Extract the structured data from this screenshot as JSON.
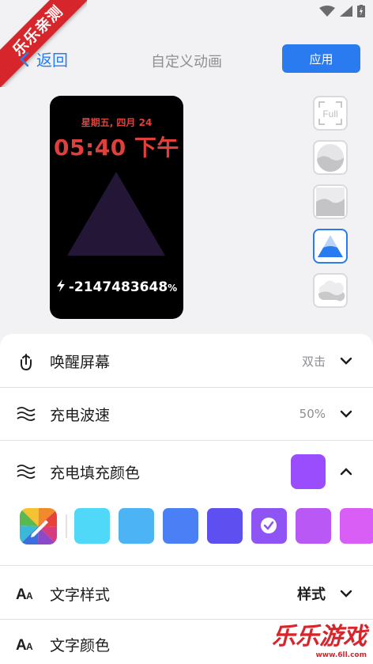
{
  "ribbon": "乐乐亲测",
  "nav": {
    "back_label": "返回",
    "title": "自定义动画",
    "apply_label": "应用"
  },
  "preview": {
    "date": "星期五, 四月 24",
    "time": "05:40 下午",
    "charge_value": "-2147483648",
    "charge_unit": "%"
  },
  "style_options": [
    {
      "name": "full",
      "label": "Full",
      "selected": false
    },
    {
      "name": "wave-circle",
      "selected": false
    },
    {
      "name": "wave-square",
      "selected": false
    },
    {
      "name": "triangle",
      "selected": true
    },
    {
      "name": "cloud",
      "selected": false
    }
  ],
  "settings": {
    "wake": {
      "label": "唤醒屏幕",
      "value": "双击"
    },
    "wave_speed": {
      "label": "充电波速",
      "value": "50%"
    },
    "fill_color": {
      "label": "充电填充颜色",
      "color": "#9a4dfc"
    },
    "text_style": {
      "label": "文字样式",
      "value": "样式"
    },
    "text_color": {
      "label": "文字颜色"
    }
  },
  "palette": {
    "colors": [
      "#4fd8f7",
      "#4cb4f4",
      "#4b7ff5",
      "#5d4ff0",
      "#8f55f4",
      "#ba58f6",
      "#d95ef5"
    ],
    "selected_index": 4
  },
  "watermark": {
    "text": "乐乐游戏",
    "sub": "www.6ll.com"
  }
}
